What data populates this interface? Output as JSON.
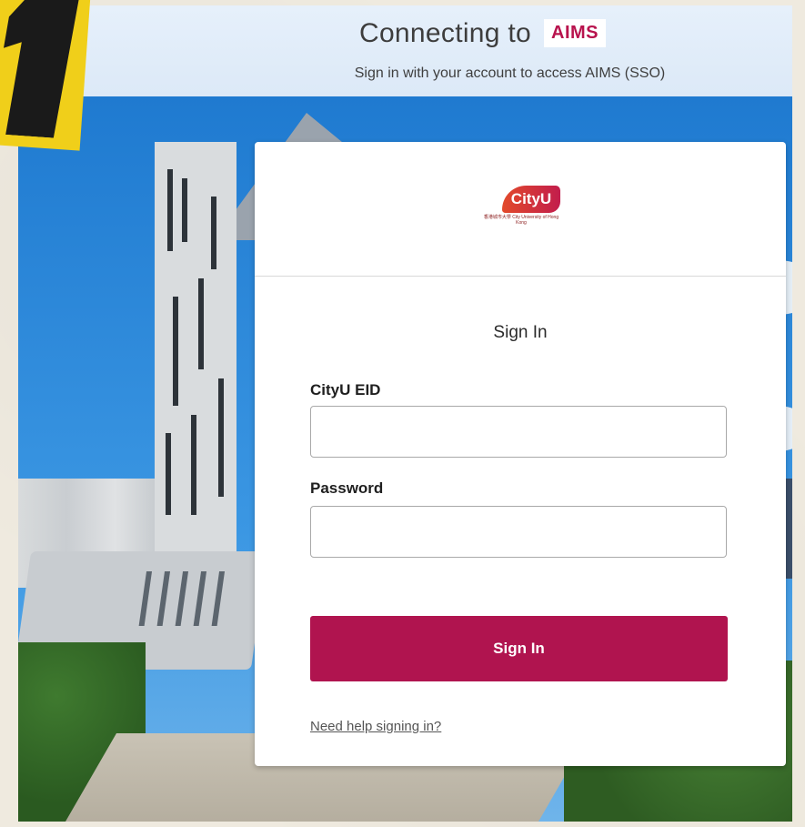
{
  "header": {
    "title_prefix": "Connecting to",
    "app_chip": "AIMS",
    "subtitle": "Sign in with your account to access AIMS (SSO)"
  },
  "logo": {
    "wordmark": "CityU",
    "tagline": "香港城市大學 City University of Hong Kong"
  },
  "form": {
    "title": "Sign In",
    "eid_label": "CityU EID",
    "eid_value": "",
    "password_label": "Password",
    "password_value": "",
    "submit_label": "Sign In",
    "help_link": "Need help signing in?"
  },
  "colors": {
    "brand_accent": "#b0144f",
    "chip_text": "#b8134d",
    "sticker_yellow": "#f0cf1a"
  }
}
